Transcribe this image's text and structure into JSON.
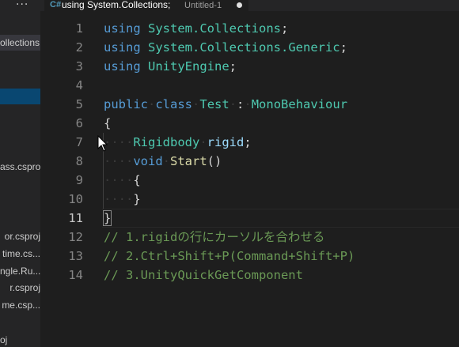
{
  "sidebar": {
    "more_label": "···",
    "items": [
      {
        "label": "ollections;..."
      },
      {
        "label": ""
      },
      {
        "label": "ass.csproj"
      },
      {
        "label": "or.csproj"
      },
      {
        "label": "time.cs..."
      },
      {
        "label": "ngle.Ru..."
      },
      {
        "label": "r.csproj"
      },
      {
        "label": "me.csp..."
      },
      {
        "label": "oj"
      }
    ]
  },
  "tab": {
    "icon": "C#",
    "title": "using System.Collections;",
    "description": "Untitled-1"
  },
  "editor": {
    "lines": [
      {
        "n": "1"
      },
      {
        "n": "2"
      },
      {
        "n": "3"
      },
      {
        "n": "4"
      },
      {
        "n": "5"
      },
      {
        "n": "6"
      },
      {
        "n": "7"
      },
      {
        "n": "8"
      },
      {
        "n": "9"
      },
      {
        "n": "10"
      },
      {
        "n": "11"
      },
      {
        "n": "12"
      },
      {
        "n": "13"
      },
      {
        "n": "14"
      }
    ],
    "tokens": {
      "using": "using",
      "ns1": "System.Collections",
      "ns2": "System.Collections.Generic",
      "ns3": "UnityEngine",
      "semi": ";",
      "public": "public",
      "class": "class",
      "classname": "Test",
      "colon": ":",
      "base": "MonoBehaviour",
      "open": "{",
      "close": "}",
      "rbtype": "Rigidbody",
      "rbvar": "rigid",
      "void": "void",
      "start": "Start",
      "parens": "()",
      "comment1": "// 1.rigidの行にカーソルを合わせる",
      "comment2": "// 2.Ctrl+Shift+P(Command+Shift+P)",
      "comment3": "// 3.UnityQuickGetComponent"
    }
  }
}
